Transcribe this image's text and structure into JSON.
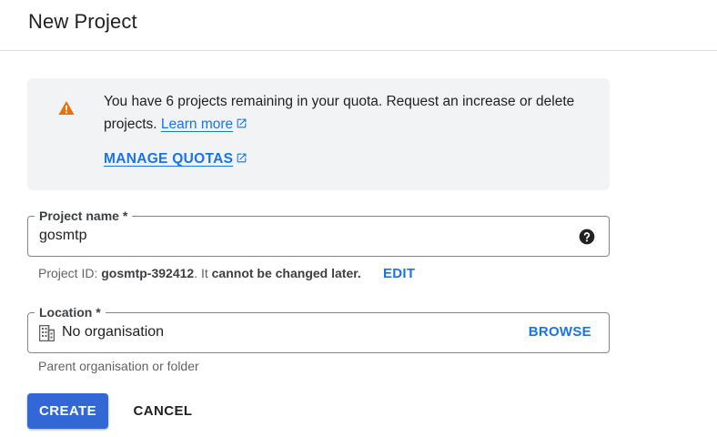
{
  "header": {
    "title": "New Project"
  },
  "notice": {
    "text": "You have 6 projects remaining in your quota. Request an increase or delete projects.",
    "learn_more": "Learn more",
    "manage_quotas": "MANAGE QUOTAS",
    "icon": "warning-icon"
  },
  "project_name": {
    "label": "Project name *",
    "value": "gosmtp",
    "icon": "help-icon"
  },
  "project_id": {
    "prefix": "Project ID: ",
    "value": "gosmtp-392412",
    "mid": ". It ",
    "emphasis": "cannot be changed later.",
    "edit_label": "EDIT"
  },
  "location": {
    "label": "Location *",
    "value": "No organisation",
    "browse_label": "BROWSE",
    "icon": "building-icon",
    "helper": "Parent organisation or folder"
  },
  "actions": {
    "create_label": "CREATE",
    "cancel_label": "CANCEL"
  },
  "colors": {
    "accent": "#1a73e8",
    "primary_button": "#3367d6",
    "warning": "#e8710a",
    "notice_bg": "#f1f3f4"
  }
}
